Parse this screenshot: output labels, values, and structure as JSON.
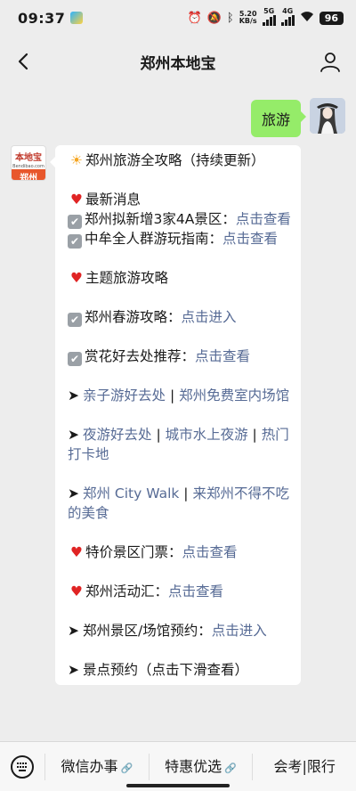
{
  "status": {
    "time": "09:37",
    "net_speed_value": "5.20",
    "net_speed_unit": "KB/s",
    "net_5g": "5G",
    "net_4g": "4G",
    "battery": "96"
  },
  "header": {
    "title": "郑州本地宝"
  },
  "chat": {
    "user_message": "旅游",
    "brand_avatar": {
      "logo_text": "本地宝",
      "logo_domain": "Bendibao.com",
      "city": "郑州"
    },
    "reply": {
      "title": "郑州旅游全攻略（持续更新）",
      "latest_news": "最新消息",
      "news1_text": "郑州拟新增3家4A景区：",
      "news1_link": "点击查看",
      "news2_text": "中牟全人群游玩指南：",
      "news2_link": "点击查看",
      "theme": "主题旅游攻略",
      "spring_text": "郑州春游攻略：",
      "spring_link": "点击进入",
      "flowers_text": "赏花好去处推荐：",
      "flowers_link": "点击查看",
      "kids_link1": "亲子游好去处",
      "sep": " | ",
      "kids_link2": "郑州免费室内场馆",
      "night_link1": "夜游好去处",
      "night_link2": "城市水上夜游",
      "night_link3": "热门打卡地",
      "citywalk_link1": "郑州 City Walk",
      "citywalk_link2": "来郑州不得不吃的美食",
      "tickets_text": "特价景区门票：",
      "tickets_link": "点击查看",
      "events_text": "郑州活动汇：",
      "events_link": "点击查看",
      "booking_text": "郑州景区/场馆预约：",
      "booking_link": "点击进入",
      "reserve_text": "景点预约（点击下滑查看）"
    }
  },
  "bottom_menu": {
    "items": [
      "微信办事",
      "特惠优选",
      "会考|限行"
    ]
  },
  "icons": {
    "back": "chevron-left-icon",
    "profile": "person-icon",
    "keyboard": "keyboard-icon",
    "heart": "red-heart-icon",
    "check": "check-box-icon",
    "sun": "sun-icon",
    "arrow": "arrow-right-icon"
  },
  "colors": {
    "link": "#576b95",
    "user_bubble": "#95ec69",
    "heart": "#e02424"
  }
}
